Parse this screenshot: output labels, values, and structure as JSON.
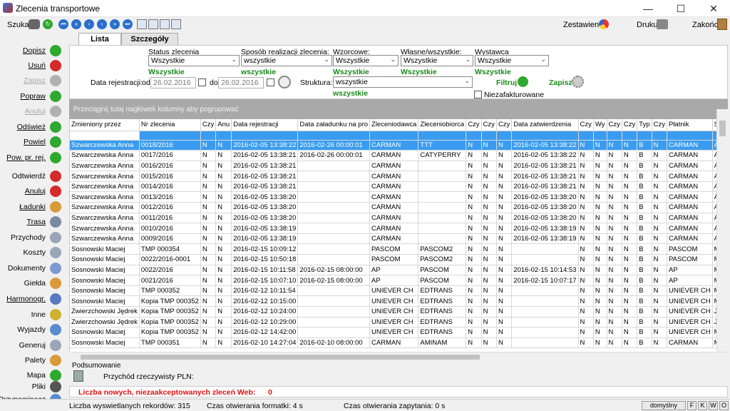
{
  "window": {
    "title": "Zlecenia transportowe",
    "minimize": "—",
    "maximize": "☐",
    "close": "✕"
  },
  "toolbar": {
    "search_label": "Szukaj",
    "reports_label": "Zestawienia",
    "print_label": "Drukuj",
    "exit_label": "Zakończ"
  },
  "tabs": [
    {
      "label": "Lista"
    },
    {
      "label": "Szczegóły"
    }
  ],
  "filters": {
    "status_label": "Status zlecenia",
    "status_value": "Wszystkie",
    "status_green": "Wszystkie",
    "method_label": "Sposób realizacji zlecenia:",
    "method_value": "wszystkie",
    "method_green": "wszystkie",
    "templates_label": "Wzorcowe:",
    "templates_value": "Wszystkie",
    "templates_green": "Wszystkie",
    "own_label": "Własne/wszystkie:",
    "own_value": "Wszystkie",
    "own_green": "Wszystkie",
    "issuer_label": "Wystawca",
    "issuer_value": "Wszystkie",
    "issuer_green": "Wszystkie",
    "regdate_label": "Data rejestracji:",
    "from_label": "od",
    "from_value": "26.02.2016",
    "to_label": "do",
    "to_value": "26.02.2016",
    "structure_label": "Struktura:",
    "structure_value": "wszystkie",
    "structure_green": "wszystkie",
    "filter_button": "Filtruj",
    "save_button": "Zapisz",
    "uninvoiced_label": "Niezafakturowane"
  },
  "sidebar": [
    {
      "label": "Dopisz",
      "name": "dopisz",
      "underline": true,
      "disabled": false,
      "color": "#2fa82f"
    },
    {
      "label": "Usuń",
      "name": "usun",
      "underline": true,
      "disabled": false,
      "color": "#d42b2b"
    },
    {
      "label": "Zapisz",
      "name": "zapisz",
      "underline": true,
      "disabled": true,
      "color": "#b0b0b0"
    },
    {
      "label": "Popraw",
      "name": "popraw",
      "underline": true,
      "disabled": false,
      "color": "#2fa82f"
    },
    {
      "label": "Anuluj",
      "name": "anuluj-top",
      "underline": true,
      "disabled": true,
      "color": "#b0b0b0"
    },
    {
      "label": "Odśwież",
      "name": "odswiez",
      "underline": true,
      "disabled": false,
      "color": "#2fa82f"
    },
    {
      "label": "Powiel",
      "name": "powiel",
      "underline": true,
      "disabled": false,
      "color": "#2fa82f"
    },
    {
      "label": "Pow. pr. rej.",
      "name": "pow-pr-rej",
      "underline": true,
      "disabled": false,
      "color": "#2fa82f"
    },
    {
      "label": "Odtwierdź",
      "name": "odtwierdz",
      "underline": false,
      "disabled": false,
      "color": "#d42b2b"
    },
    {
      "label": "Anuluj",
      "name": "anuluj",
      "underline": true,
      "disabled": false,
      "color": "#d42b2b"
    },
    {
      "label": "Ładunki",
      "name": "ladunki",
      "underline": true,
      "disabled": false,
      "color": "#d99a3a"
    },
    {
      "label": "Trasa",
      "name": "trasa",
      "underline": true,
      "disabled": false,
      "color": "#7a8aa0"
    },
    {
      "label": "Przychody",
      "name": "przychody",
      "underline": false,
      "disabled": false,
      "color": "#9aa6b8"
    },
    {
      "label": "Koszty",
      "name": "koszty",
      "underline": false,
      "disabled": false,
      "color": "#9aa6b8"
    },
    {
      "label": "Dokumenty",
      "name": "dokumenty",
      "underline": false,
      "disabled": false,
      "color": "#7a9ad0"
    },
    {
      "label": "Giełda",
      "name": "gielda",
      "underline": false,
      "disabled": false,
      "color": "#d99a3a"
    },
    {
      "label": "Harmonogr.",
      "name": "harmonogr",
      "underline": true,
      "disabled": false,
      "color": "#5a7ac0"
    },
    {
      "label": "Inne",
      "name": "inne",
      "underline": false,
      "disabled": false,
      "color": "#d0b030"
    },
    {
      "label": "Wyjazdy",
      "name": "wyjazdy",
      "underline": false,
      "disabled": false,
      "color": "#5a8ad0"
    },
    {
      "label": "Generuj",
      "name": "generuj",
      "underline": false,
      "disabled": false,
      "color": "#9aa6b8"
    },
    {
      "label": "Palety",
      "name": "palety",
      "underline": false,
      "disabled": false,
      "color": "#d99a3a"
    },
    {
      "label": "Mapa",
      "name": "mapa",
      "underline": false,
      "disabled": false,
      "color": "#2fa82f"
    },
    {
      "label": "Pliki",
      "name": "pliki",
      "underline": false,
      "disabled": false,
      "color": "#555555"
    },
    {
      "label": "Przypominacz",
      "name": "przypominacz",
      "underline": false,
      "disabled": false,
      "color": "#5a8ad0"
    }
  ],
  "grid": {
    "group_hint": "Przeciągnij tutaj nagłówek kolumny aby pogrupować",
    "columns": [
      "Zmieniony przez",
      "Nr zlecenia",
      "Czy",
      "Anu",
      "Data rejestracji",
      "Data załadunku na pro",
      "Zleceniodawca",
      "Zleceniobiorca",
      "Czy",
      "Czy",
      "Czy",
      "Data zatwierdzenia",
      "Czy",
      "Wy",
      "Czy",
      "Czy",
      "Typ",
      "Czy",
      "Płatnik",
      "Spe"
    ],
    "rows": [
      [
        "Szwarczewska Anna",
        "0018/2016",
        "N",
        "N",
        "2016-02-05 13:38:22",
        "2016-02-26 00:00:01",
        "CARMAN",
        "TTT",
        "N",
        "N",
        "N",
        "2016-02-05 13:38:22",
        "N",
        "N",
        "N",
        "N",
        "B",
        "N",
        "CARMAN",
        "Ann"
      ],
      [
        "Szwarczewska Anna",
        "0017/2016",
        "N",
        "N",
        "2016-02-05 13:38:21",
        "2016-02-26 00:00:01",
        "CARMAN",
        "CATYPERRY",
        "N",
        "N",
        "N",
        "2016-02-05 13:38:22",
        "N",
        "N",
        "N",
        "N",
        "B",
        "N",
        "CARMAN",
        "Ann"
      ],
      [
        "Szwarczewska Anna",
        "0016/2016",
        "N",
        "N",
        "2016-02-05 13:38:21",
        "",
        "CARMAN",
        "",
        "N",
        "N",
        "N",
        "2016-02-05 13:38:21",
        "N",
        "N",
        "N",
        "N",
        "B",
        "N",
        "CARMAN",
        "Ann"
      ],
      [
        "Szwarczewska Anna",
        "0015/2016",
        "N",
        "N",
        "2016-02-05 13:38:21",
        "",
        "CARMAN",
        "",
        "N",
        "N",
        "N",
        "2016-02-05 13:38:21",
        "N",
        "N",
        "N",
        "N",
        "B",
        "N",
        "CARMAN",
        "Ann"
      ],
      [
        "Szwarczewska Anna",
        "0014/2016",
        "N",
        "N",
        "2016-02-05 13:38:21",
        "",
        "CARMAN",
        "",
        "N",
        "N",
        "N",
        "2016-02-05 13:38:21",
        "N",
        "N",
        "N",
        "N",
        "B",
        "N",
        "CARMAN",
        "Ann"
      ],
      [
        "Szwarczewska Anna",
        "0013/2016",
        "N",
        "N",
        "2016-02-05 13:38:20",
        "",
        "CARMAN",
        "",
        "N",
        "N",
        "N",
        "2016-02-05 13:38:20",
        "N",
        "N",
        "N",
        "N",
        "B",
        "N",
        "CARMAN",
        "Ann"
      ],
      [
        "Szwarczewska Anna",
        "0012/2016",
        "N",
        "N",
        "2016-02-05 13:38:20",
        "",
        "CARMAN",
        "",
        "N",
        "N",
        "N",
        "2016-02-05 13:38:20",
        "N",
        "N",
        "N",
        "N",
        "B",
        "N",
        "CARMAN",
        "Ann"
      ],
      [
        "Szwarczewska Anna",
        "0011/2016",
        "N",
        "N",
        "2016-02-05 13:38:20",
        "",
        "CARMAN",
        "",
        "N",
        "N",
        "N",
        "2016-02-05 13:38:20",
        "N",
        "N",
        "N",
        "N",
        "B",
        "N",
        "CARMAN",
        "Ann"
      ],
      [
        "Szwarczewska Anna",
        "0010/2016",
        "N",
        "N",
        "2016-02-05 13:38:19",
        "",
        "CARMAN",
        "",
        "N",
        "N",
        "N",
        "2016-02-05 13:38:19",
        "N",
        "N",
        "N",
        "N",
        "B",
        "N",
        "CARMAN",
        "Ann"
      ],
      [
        "Szwarczewska Anna",
        "0009/2016",
        "N",
        "N",
        "2016-02-05 13:38:19",
        "",
        "CARMAN",
        "",
        "N",
        "N",
        "N",
        "2016-02-05 13:38:19",
        "N",
        "N",
        "N",
        "N",
        "B",
        "N",
        "CARMAN",
        "Ann"
      ],
      [
        "Sosnowski Maciej",
        "TMP 000354",
        "N",
        "N",
        "2016-02-15 10:09:12",
        "",
        "PASCOM",
        "PASCOM2",
        "N",
        "N",
        "N",
        "",
        "N",
        "N",
        "N",
        "N",
        "B",
        "N",
        "PASCOM",
        "MAC"
      ],
      [
        "Sosnowski Maciej",
        "0022/2016-0001",
        "N",
        "N",
        "2016-02-15 10:50:18",
        "",
        "PASCOM",
        "PASCOM2",
        "N",
        "N",
        "N",
        "",
        "N",
        "N",
        "N",
        "N",
        "B",
        "N",
        "PASCOM",
        "MAC"
      ],
      [
        "Sosnowski Maciej",
        "0022/2016",
        "N",
        "N",
        "2016-02-15 10:11:58",
        "2016-02-15 08:00:00",
        "AP",
        "PASCOM",
        "N",
        "N",
        "N",
        "2016-02-15 10:14:53",
        "N",
        "N",
        "N",
        "N",
        "B",
        "N",
        "AP",
        "MAC"
      ],
      [
        "Sosnowski Maciej",
        "0021/2016",
        "N",
        "N",
        "2016-02-15 10:07:10",
        "2016-02-15 08:00:00",
        "AP",
        "PASCOM",
        "N",
        "N",
        "N",
        "2016-02-15 10:07:17",
        "N",
        "N",
        "N",
        "N",
        "B",
        "N",
        "AP",
        "MAC"
      ],
      [
        "Sosnowski Maciej",
        "TMP 000352",
        "N",
        "N",
        "2016-02-12 10:11:54",
        "",
        "UNIEVER CH",
        "EDTRANS",
        "N",
        "N",
        "N",
        "",
        "N",
        "N",
        "N",
        "N",
        "B",
        "N",
        "UNIEVER CH",
        "MAC"
      ],
      [
        "Sosnowski Maciej",
        "Kopia TMP 000352",
        "N",
        "N",
        "2016-02-12 10:15:00",
        "",
        "UNIEVER CH",
        "EDTRANS",
        "N",
        "N",
        "N",
        "",
        "N",
        "N",
        "N",
        "N",
        "B",
        "N",
        "UNIEVER CH",
        "MAC"
      ],
      [
        "Zwierzchowski Jędrek",
        "Kopia TMP 000352",
        "N",
        "N",
        "2016-02-12 10:24:00",
        "",
        "UNIEVER CH",
        "EDTRANS",
        "N",
        "N",
        "N",
        "",
        "N",
        "N",
        "N",
        "N",
        "B",
        "N",
        "UNIEVER CH",
        "Jędr"
      ],
      [
        "Zwierzchowski Jędrek",
        "Kopia TMP 000352",
        "N",
        "N",
        "2016-02-12 10:29:00",
        "",
        "UNIEVER CH",
        "EDTRANS",
        "N",
        "N",
        "N",
        "",
        "N",
        "N",
        "N",
        "N",
        "B",
        "N",
        "UNIEVER CH",
        "Jędr"
      ],
      [
        "Sosnowski Maciej",
        "Kopia TMP 000352",
        "N",
        "N",
        "2016-02-12 14:42:00",
        "",
        "UNIEVER CH",
        "EDTRANS",
        "N",
        "N",
        "N",
        "",
        "N",
        "N",
        "N",
        "N",
        "B",
        "N",
        "UNIEVER CH",
        "MAC"
      ],
      [
        "Sosnowski Maciej",
        "TMP 000351",
        "N",
        "N",
        "2016-02-10 14:27:04",
        "2016-02-10 08:00:00",
        "CARMAN",
        "AMINAM",
        "N",
        "N",
        "N",
        "",
        "N",
        "N",
        "N",
        "N",
        "B",
        "N",
        "CARMAN",
        "MAC"
      ]
    ]
  },
  "summary": {
    "title": "Podsumowanie",
    "revenue_label": "Przychód rzeczywisty PLN:"
  },
  "web_alert": {
    "label": "Liczba nowych, niezaakceptowanych zleceń Web:",
    "count": "0"
  },
  "status": {
    "records": "Liczba wyswietlanych rekordów: 315",
    "format_time": "Czas otwierania formatki: 4 s",
    "query_time": "Czas otwierania zapytania: 0 s",
    "layout": "domyślny",
    "btn_f": "F",
    "btn_k": "K",
    "btn_w": "W",
    "btn_o": "O"
  }
}
